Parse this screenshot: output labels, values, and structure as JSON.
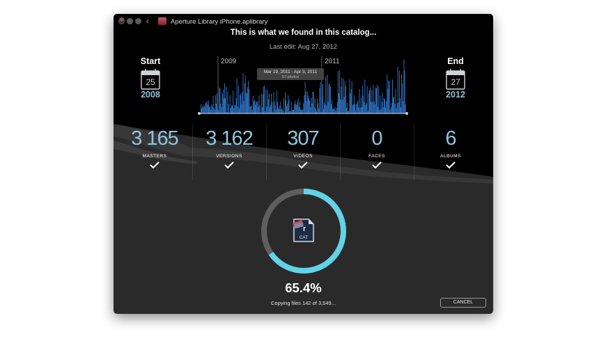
{
  "window": {
    "title": "Aperture Library iPhone.aplibrary",
    "heading": "This is what we found in this catalog...",
    "last_edit": "Last edit: Aug 27, 2012"
  },
  "timeline": {
    "start": {
      "label": "Start",
      "day": "25",
      "year": "2008"
    },
    "end": {
      "label": "End",
      "day": "27",
      "year": "2012"
    },
    "tick_2009": "2009",
    "tick_2011": "2011",
    "tooltip_range": "Mar 19, 2011 - Apr 3, 2011",
    "tooltip_count": "57 photos"
  },
  "stats": [
    {
      "value": "3 165",
      "label": "MASTERS"
    },
    {
      "value": "3 162",
      "label": "VERSIONS"
    },
    {
      "value": "307",
      "label": "VIDEOS"
    },
    {
      "value": "0",
      "label": "FACES"
    },
    {
      "value": "6",
      "label": "ALBUMS"
    }
  ],
  "progress": {
    "percent_text": "65.4%",
    "fraction": 0.654,
    "status": "Copying files 142 of 3,549..."
  },
  "app_icon_text": "CAT",
  "cancel_label": "CANCEL",
  "colors": {
    "accent": "#62d2e6",
    "bars": "#2f78cc",
    "stat_number": "#8ec6e0",
    "year": "#8fc3d6"
  },
  "icons": {
    "check": "checkmark-icon",
    "calendar": "calendar-icon"
  }
}
